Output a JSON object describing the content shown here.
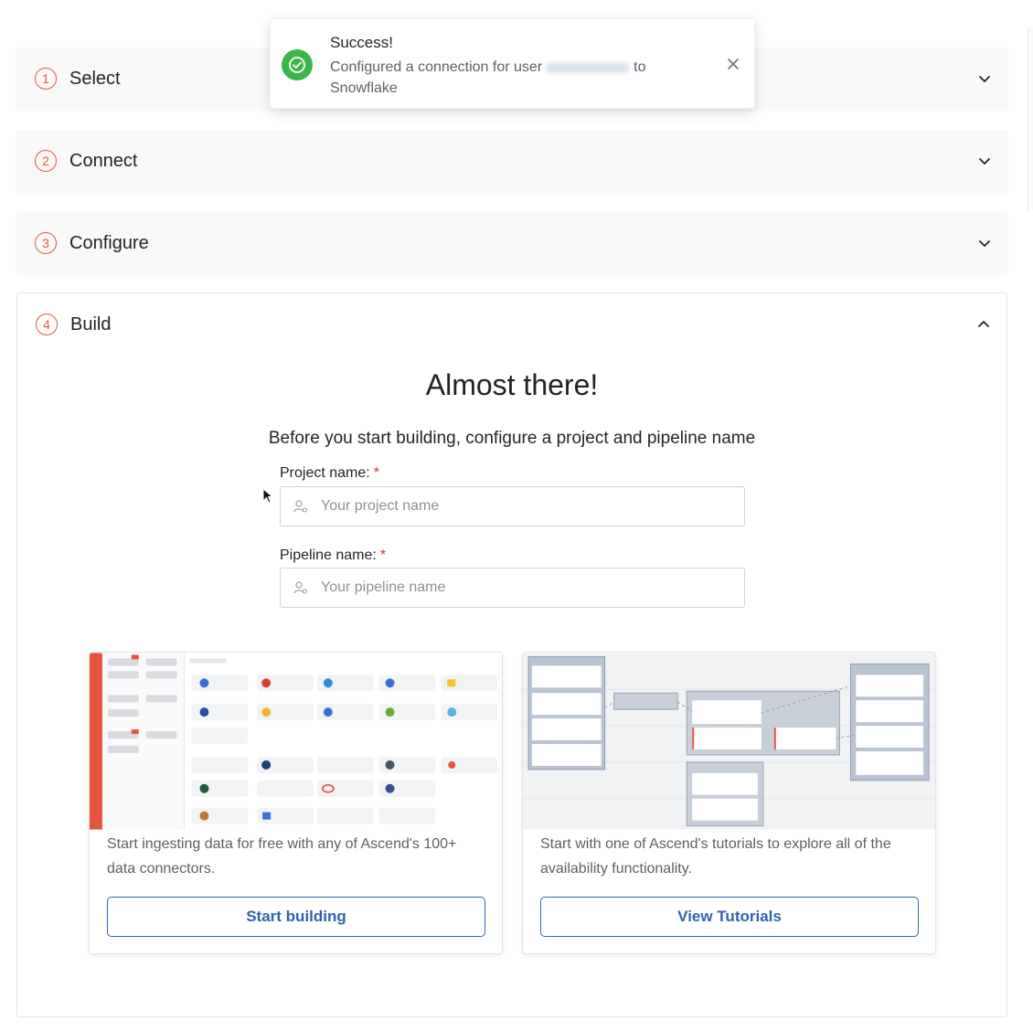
{
  "steps": [
    {
      "number": "1",
      "label": "Select"
    },
    {
      "number": "2",
      "label": "Connect"
    },
    {
      "number": "3",
      "label": "Configure"
    },
    {
      "number": "4",
      "label": "Build"
    }
  ],
  "icons": {
    "collapsed": "chevron-down-icon",
    "expanded": "chevron-up-icon",
    "success": "check-circle-icon",
    "close": "close-icon",
    "field": "user-gear-icon"
  },
  "build": {
    "title": "Almost there!",
    "subtitle": "Before you start building, configure a project and pipeline name",
    "project": {
      "label": "Project name:",
      "required": "*",
      "placeholder": "Your project name",
      "value": ""
    },
    "pipeline": {
      "label": "Pipeline name:",
      "required": "*",
      "placeholder": "Your pipeline name",
      "value": ""
    },
    "cards": [
      {
        "text": "Start ingesting data for free with any of Ascend's 100+ data connectors.",
        "button": "Start building"
      },
      {
        "text": "Start with one of Ascend's tutorials to explore all of the availability functionality.",
        "button": "View Tutorials"
      }
    ]
  },
  "toast": {
    "title": "Success!",
    "message_prefix": "Configured a connection for user",
    "message_suffix": "to Snowflake"
  },
  "colors": {
    "accent": "#e8553e",
    "primary": "#2f62b3",
    "success": "#39b54a",
    "required": "#d2382b"
  }
}
